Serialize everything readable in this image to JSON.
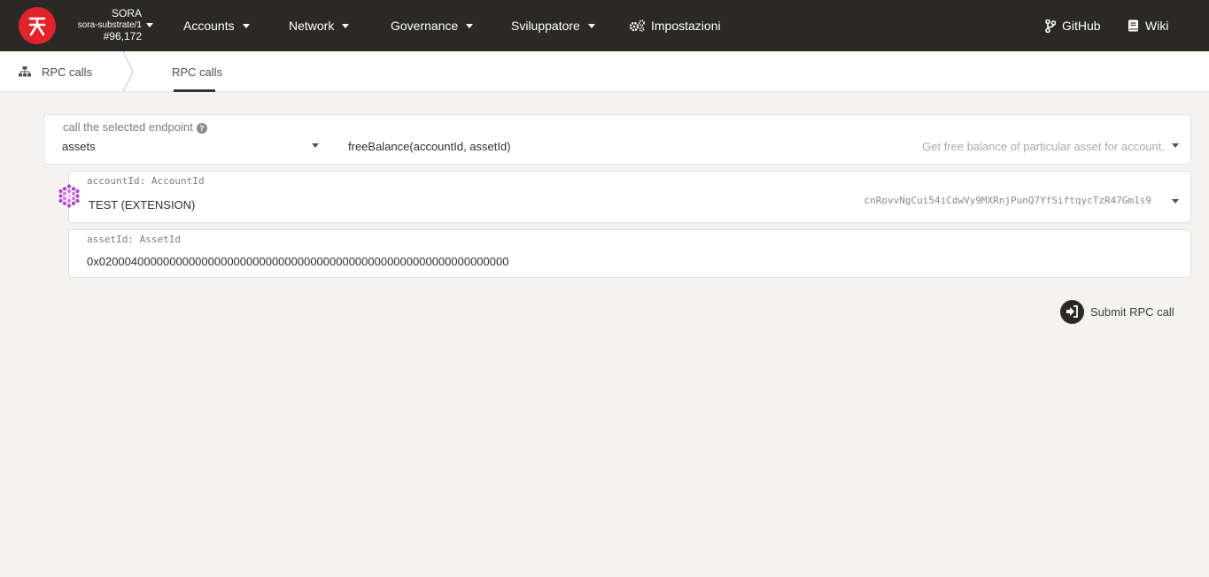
{
  "header": {
    "chain_name": "SORA",
    "spec": "sora-substrate/1",
    "block": "#96,172",
    "menu": [
      {
        "label": "Accounts"
      },
      {
        "label": "Network"
      },
      {
        "label": "Governance"
      },
      {
        "label": "Sviluppatore"
      }
    ],
    "settings_label": "Impostazioni",
    "github_label": "GitHub",
    "wiki_label": "Wiki",
    "brand_color": "#e3232c"
  },
  "subnav": {
    "crumb_label": "RPC calls",
    "active_tab": "RPC calls"
  },
  "endpoint": {
    "label": "call the selected endpoint",
    "section": "assets",
    "method": "freeBalance(accountId, assetId)",
    "description": "Get free balance of particular asset for account."
  },
  "params": {
    "account_label": "accountId: AccountId",
    "account_name": "TEST (EXTENSION)",
    "account_address": "cnRovvNgCui54iCdwVy9MXRnjPunQ7YfSiftqycTzR47Gm1s9",
    "asset_label": "assetId: AssetId",
    "asset_value": "0x0200040000000000000000000000000000000000000000000000000000000000"
  },
  "actions": {
    "submit_label": "Submit RPC call"
  }
}
